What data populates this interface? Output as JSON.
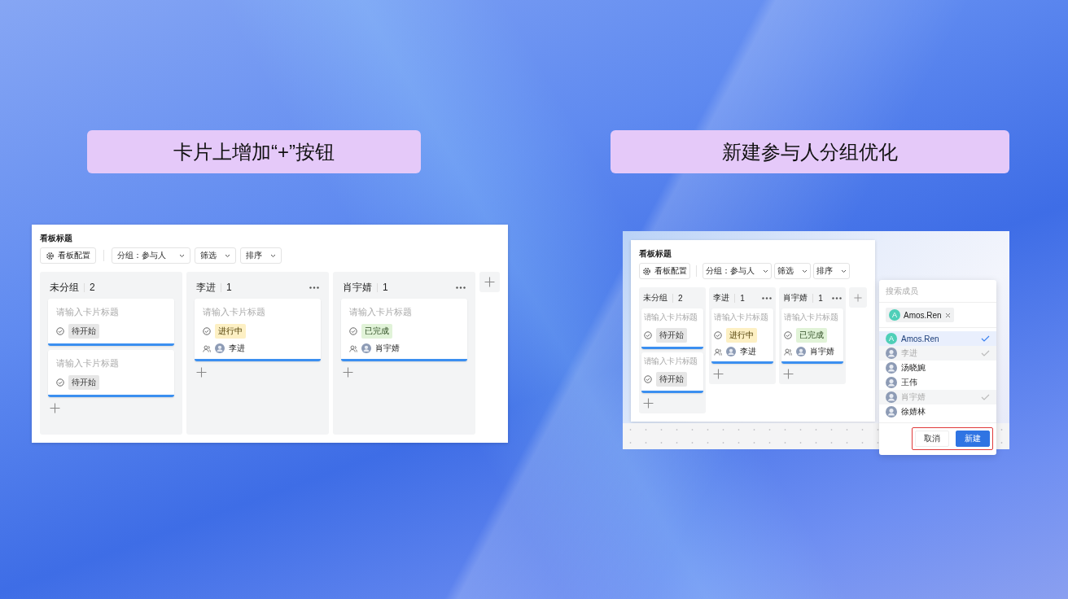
{
  "panels": [
    {
      "heading": "卡片上增加“+”按钮",
      "board": {
        "title": "看板标题",
        "config_button": "看板配置",
        "group_select": "分组：参与人",
        "filter_select": "筛选",
        "sort_select": "排序",
        "columns": [
          {
            "name": "未分组",
            "count": "2",
            "menu": false,
            "cards": [
              {
                "placeholder": "请输入卡片标题",
                "status": {
                  "label": "待开始",
                  "kind": "todo"
                }
              },
              {
                "placeholder": "请输入卡片标题",
                "status": {
                  "label": "待开始",
                  "kind": "todo"
                }
              }
            ]
          },
          {
            "name": "李进",
            "count": "1",
            "menu": true,
            "cards": [
              {
                "placeholder": "请输入卡片标题",
                "status": {
                  "label": "进行中",
                  "kind": "doing"
                },
                "assignee": "李进"
              }
            ]
          },
          {
            "name": "肖宇婧",
            "count": "1",
            "menu": true,
            "cards": [
              {
                "placeholder": "请输入卡片标题",
                "status": {
                  "label": "已完成",
                  "kind": "done"
                },
                "assignee": "肖宇婧"
              }
            ]
          }
        ]
      }
    },
    {
      "heading": "新建参与人分组优化",
      "board": {
        "title": "看板标题",
        "config_button": "看板配置",
        "group_select": "分组：参与人",
        "filter_select": "筛选",
        "sort_select": "排序",
        "columns": [
          {
            "name": "未分组",
            "count": "2",
            "menu": false,
            "cards": [
              {
                "placeholder": "请输入卡片标题",
                "status": {
                  "label": "待开始",
                  "kind": "todo"
                }
              },
              {
                "placeholder": "请输入卡片标题",
                "status": {
                  "label": "待开始",
                  "kind": "todo"
                }
              }
            ]
          },
          {
            "name": "李进",
            "count": "1",
            "menu": true,
            "cards": [
              {
                "placeholder": "请输入卡片标题",
                "status": {
                  "label": "进行中",
                  "kind": "doing"
                },
                "assignee": "李进"
              }
            ]
          },
          {
            "name": "肖宇婧",
            "count": "1",
            "menu": true,
            "cards": [
              {
                "placeholder": "请输入卡片标题",
                "status": {
                  "label": "已完成",
                  "kind": "done"
                },
                "assignee": "肖宇婧"
              }
            ]
          }
        ]
      },
      "member_picker": {
        "search": {
          "placeholder": "搜索成员"
        },
        "chips": [
          {
            "letter": "A",
            "name": "Amos.Ren"
          }
        ],
        "members": [
          {
            "name": "Amos.Ren",
            "letter": "A",
            "selected": true,
            "disabled": false
          },
          {
            "name": "李进",
            "selected": true,
            "disabled": true
          },
          {
            "name": "汤晓婉",
            "selected": false,
            "disabled": false
          },
          {
            "name": "王伟",
            "selected": false,
            "disabled": false
          },
          {
            "name": "肖宇婧",
            "selected": true,
            "disabled": true
          },
          {
            "name": "徐婧林",
            "selected": false,
            "disabled": false
          }
        ],
        "buttons": [
          {
            "label": "取消",
            "kind": "secondary"
          },
          {
            "label": "新建",
            "kind": "primary"
          }
        ],
        "buttons_highlighted": true
      }
    }
  ]
}
